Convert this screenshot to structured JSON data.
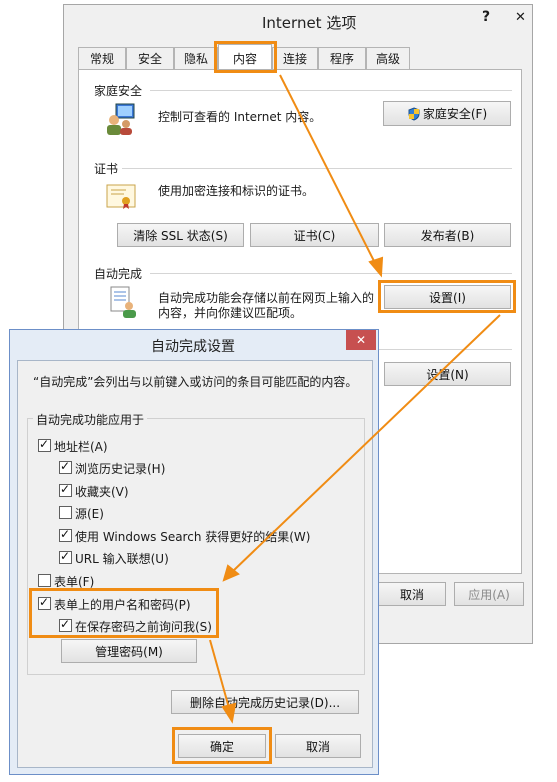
{
  "outer": {
    "title": "Internet 选项",
    "help": "?",
    "close": "✕",
    "tabs": [
      "常规",
      "安全",
      "隐私",
      "内容",
      "连接",
      "程序",
      "高级"
    ],
    "family": {
      "heading": "家庭安全",
      "desc": "控制可查看的 Internet 内容。",
      "button": "家庭安全(F)"
    },
    "cert": {
      "heading": "证书",
      "desc": "使用加密连接和标识的证书。",
      "btn_ssl": "清除 SSL 状态(S)",
      "btn_cert": "证书(C)",
      "btn_pub": "发布者(B)"
    },
    "auto": {
      "heading": "自动完成",
      "desc1": "自动完成功能会存储以前在网页上输入的",
      "desc2": "内容，并向你建议匹配项。",
      "button": "设置(I)"
    },
    "feeds_button": "设置(N)",
    "cancel": "取消",
    "apply": "应用(A)"
  },
  "inner": {
    "title": "自动完成设置",
    "close": "✕",
    "intro": "“自动完成”会列出与以前键入或访问的条目可能匹配的内容。",
    "group": "自动完成功能应用于",
    "items": {
      "address": "地址栏(A)",
      "history": "浏览历史记录(H)",
      "favorites": "收藏夹(V)",
      "feeds": "源(E)",
      "wsearch": "使用 Windows Search 获得更好的结果(W)",
      "url": "URL 输入联想(U)",
      "forms": "表单(F)",
      "userpass": "表单上的用户名和密码(P)",
      "ask": "在保存密码之前询问我(S)"
    },
    "manage": "管理密码(M)",
    "delete": "删除自动完成历史记录(D)...",
    "ok": "确定",
    "cancel": "取消"
  },
  "colors": {
    "highlight": "#f08c14",
    "close_red": "#c75050"
  },
  "icons": [
    "help-icon",
    "close-icon",
    "family-safety-icon",
    "shield-icon",
    "certificate-icon",
    "autocomplete-icon",
    "checkbox-check-icon"
  ]
}
